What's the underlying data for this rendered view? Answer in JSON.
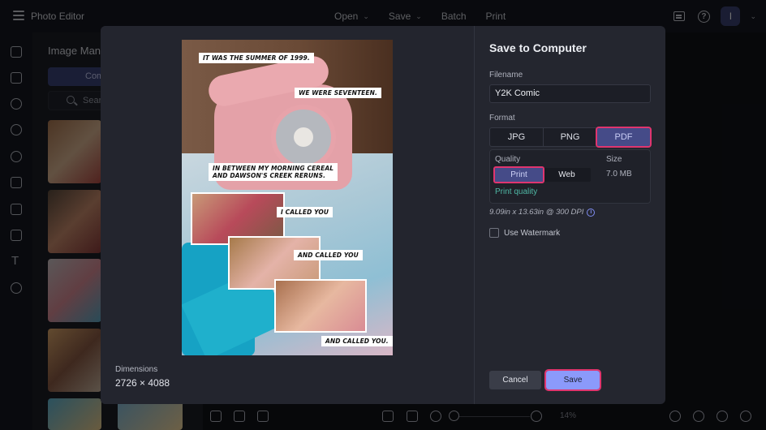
{
  "app": {
    "title": "Photo Editor",
    "nav": [
      {
        "label": "Open",
        "has_dropdown": true
      },
      {
        "label": "Save",
        "has_dropdown": true
      },
      {
        "label": "Batch",
        "has_dropdown": false
      },
      {
        "label": "Print",
        "has_dropdown": false
      }
    ],
    "avatar_initial": "I",
    "icons": [
      "menu-icon",
      "feedback-icon",
      "help-icon",
      "chevron-down-icon"
    ]
  },
  "rail": {
    "items": [
      "image-manager-icon",
      "adjust-icon",
      "eye-icon",
      "effects-icon",
      "palette-icon",
      "frame-icon",
      "grid-icon",
      "texture-icon",
      "text-icon",
      "sticker-icon"
    ]
  },
  "side_panel": {
    "title": "Image Manager",
    "tab_label": "Computer",
    "search_placeholder": "Search"
  },
  "bottom_toolbar": {
    "zoom_percent": "14%",
    "zoom_level": 0.14
  },
  "dialog": {
    "title": "Save to Computer",
    "filename_label": "Filename",
    "filename_value": "Y2K Comic",
    "format_label": "Format",
    "formats": [
      {
        "label": "JPG",
        "active": false
      },
      {
        "label": "PNG",
        "active": false
      },
      {
        "label": "PDF",
        "active": true
      }
    ],
    "quality_label": "Quality",
    "quality_options": [
      {
        "label": "Print",
        "active": true
      },
      {
        "label": "Web",
        "active": false
      }
    ],
    "quality_description": "Print quality",
    "size_label": "Size",
    "size_value": "7.0 MB",
    "dpi_text": "9.09in x 13.63in @ 300 DPI",
    "watermark_label": "Use Watermark",
    "watermark_checked": false,
    "cancel_label": "Cancel",
    "save_label": "Save",
    "dimensions_label": "Dimensions",
    "dimensions_value": "2726 × 4088",
    "highlight_color": "#e0356f",
    "accent_color": "#8b9afb"
  },
  "comic": {
    "captions": [
      "IT WAS THE SUMMER OF 1999.",
      "WE WERE SEVENTEEN.",
      "IN BETWEEN MY MORNING CEREAL",
      "AND DAWSON'S CREEK RERUNS.",
      "I CALLED YOU",
      "AND CALLED YOU",
      "AND CALLED YOU."
    ]
  }
}
